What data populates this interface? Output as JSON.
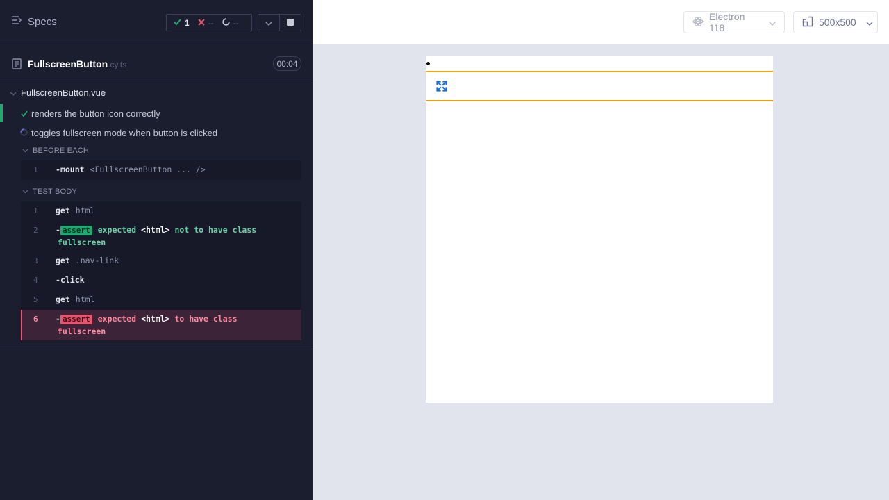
{
  "reporter": {
    "specs_label": "Specs",
    "stats": {
      "passed": "1",
      "failed": "--",
      "pending": "--"
    },
    "spec_file": {
      "name": "FullscreenButton",
      "ext": ".cy.ts",
      "duration": "00:04"
    },
    "suite_title": "FullscreenButton.vue",
    "tests": [
      {
        "title": "renders the button icon correctly",
        "state": "passed"
      },
      {
        "title": "toggles fullscreen mode when button is clicked",
        "state": "running"
      }
    ],
    "before_each": {
      "title": "BEFORE EACH",
      "commands": [
        {
          "num": "1",
          "name": "mount",
          "arg": "<FullscreenButton ... />"
        }
      ]
    },
    "test_body": {
      "title": "TEST BODY",
      "commands": [
        {
          "num": "1",
          "name": "get",
          "arg": "html"
        },
        {
          "num": "2",
          "name": "assert",
          "expected": "expected",
          "subject": "<html>",
          "msg": "not to have class",
          "cont": "fullscreen"
        },
        {
          "num": "3",
          "name": "get",
          "arg": ".nav-link"
        },
        {
          "num": "4",
          "name": "click"
        },
        {
          "num": "5",
          "name": "get",
          "arg": "html"
        },
        {
          "num": "6",
          "name": "assert",
          "expected": "expected",
          "subject": "<html>",
          "msg": "to have class",
          "cont": "fullscreen"
        }
      ]
    }
  },
  "aut_header": {
    "browser": "Electron 118",
    "viewport": "500x500"
  },
  "colors": {
    "panel_bg": "#1b1e2e",
    "pass": "#1fa971",
    "fail": "#e45770",
    "navbar_border": "#e8a317",
    "icon_blue": "#1e6fd9"
  },
  "icons": [
    "list-icon",
    "check-icon",
    "x-icon",
    "spinner-icon",
    "chevron-down-icon",
    "stop-icon",
    "document-icon",
    "electron-icon",
    "viewport-icon",
    "expand-icon"
  ]
}
